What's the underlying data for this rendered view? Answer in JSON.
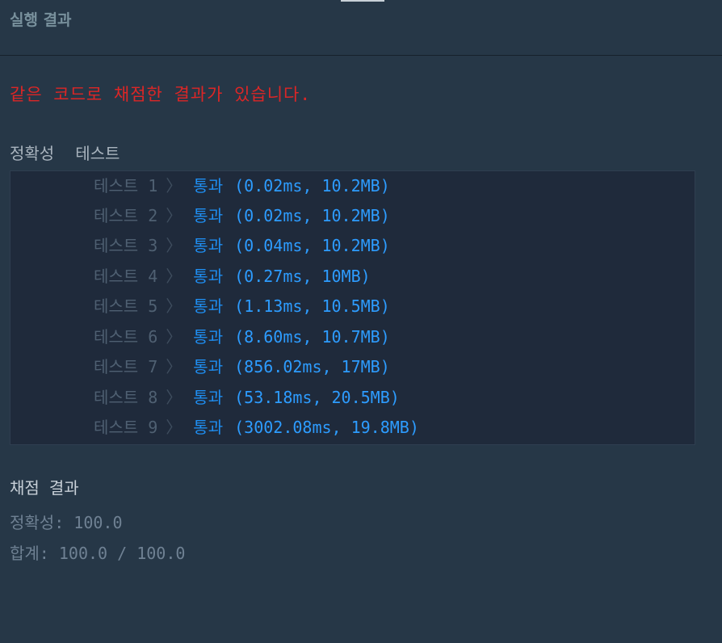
{
  "header": {
    "title": "실행 결과"
  },
  "notice": "같은 코드로 채점한 결과가 있습니다.",
  "accuracy_section": {
    "label": "정확성",
    "tab": "테스트"
  },
  "tests": [
    {
      "label": "테스트 1",
      "chevron": "〉",
      "result": "통과",
      "detail": "(0.02ms, 10.2MB)"
    },
    {
      "label": "테스트 2",
      "chevron": "〉",
      "result": "통과",
      "detail": "(0.02ms, 10.2MB)"
    },
    {
      "label": "테스트 3",
      "chevron": "〉",
      "result": "통과",
      "detail": "(0.04ms, 10.2MB)"
    },
    {
      "label": "테스트 4",
      "chevron": "〉",
      "result": "통과",
      "detail": "(0.27ms, 10MB)"
    },
    {
      "label": "테스트 5",
      "chevron": "〉",
      "result": "통과",
      "detail": "(1.13ms, 10.5MB)"
    },
    {
      "label": "테스트 6",
      "chevron": "〉",
      "result": "통과",
      "detail": "(8.60ms, 10.7MB)"
    },
    {
      "label": "테스트 7",
      "chevron": "〉",
      "result": "통과",
      "detail": "(856.02ms, 17MB)"
    },
    {
      "label": "테스트 8",
      "chevron": "〉",
      "result": "통과",
      "detail": "(53.18ms, 20.5MB)"
    },
    {
      "label": "테스트 9",
      "chevron": "〉",
      "result": "통과",
      "detail": "(3002.08ms, 19.8MB)"
    }
  ],
  "score": {
    "title": "채점 결과",
    "accuracy_label": "정확성:",
    "accuracy_value": "100.0",
    "total_label": "합계:",
    "total_value": "100.0 / 100.0"
  },
  "colors": {
    "background": "#263747",
    "error": "#dc2626",
    "pass": "#1f8ef1"
  }
}
